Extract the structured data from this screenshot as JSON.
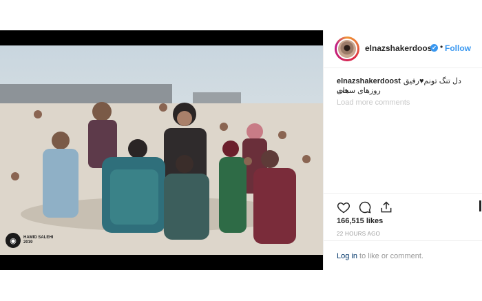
{
  "post": {
    "username": "elnazshakerdoost",
    "verified_glyph": "✔",
    "separator": "•",
    "follow_label": "Follow",
    "caption_username": "elnazshakerdoost",
    "caption_text_line1": "دل تنگ تونم♥رفیق های",
    "caption_text_line2": "روزهای سخت",
    "load_more_label": "Load more comments",
    "likes": "166,515 likes",
    "time_ago": "22 HOURS AGO",
    "login_link": "Log in",
    "login_rest": " to like or comment.",
    "watermark_line1": "HAMID SALEHI",
    "watermark_line2": "2019"
  },
  "icons": {
    "like": "heart-icon",
    "comment": "comment-icon",
    "share": "share-icon",
    "verified": "verified-badge-icon"
  },
  "colors": {
    "accent": "#3897f0",
    "text": "#262626",
    "muted": "#999999",
    "border": "#efefef"
  }
}
